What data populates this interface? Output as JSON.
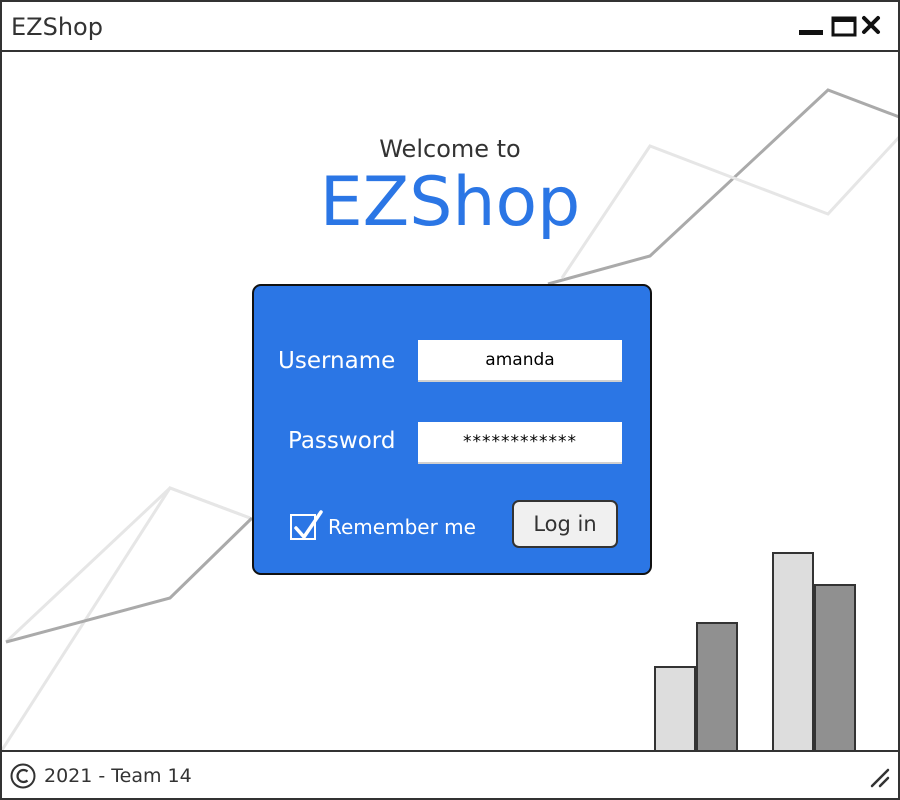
{
  "window": {
    "title": "EZShop",
    "controls": {
      "minimize": "minimize-icon",
      "maximize": "maximize-icon",
      "close": "close-icon"
    }
  },
  "hero": {
    "welcome": "Welcome to",
    "brand": "EZShop"
  },
  "login": {
    "username_label": "Username",
    "username_value": "amanda",
    "password_label": "Password",
    "password_value": "************",
    "remember_label": "Remember me",
    "remember_checked": true,
    "submit_label": "Log in"
  },
  "footer": {
    "copyright_icon": "copyright-icon",
    "copyright_text": "2021 - Team 14",
    "resize_icon": "resize-grip-icon"
  },
  "colors": {
    "accent": "#2b76e5",
    "border": "#333333",
    "bar_light": "#dddddd",
    "bar_dark": "#909090"
  }
}
